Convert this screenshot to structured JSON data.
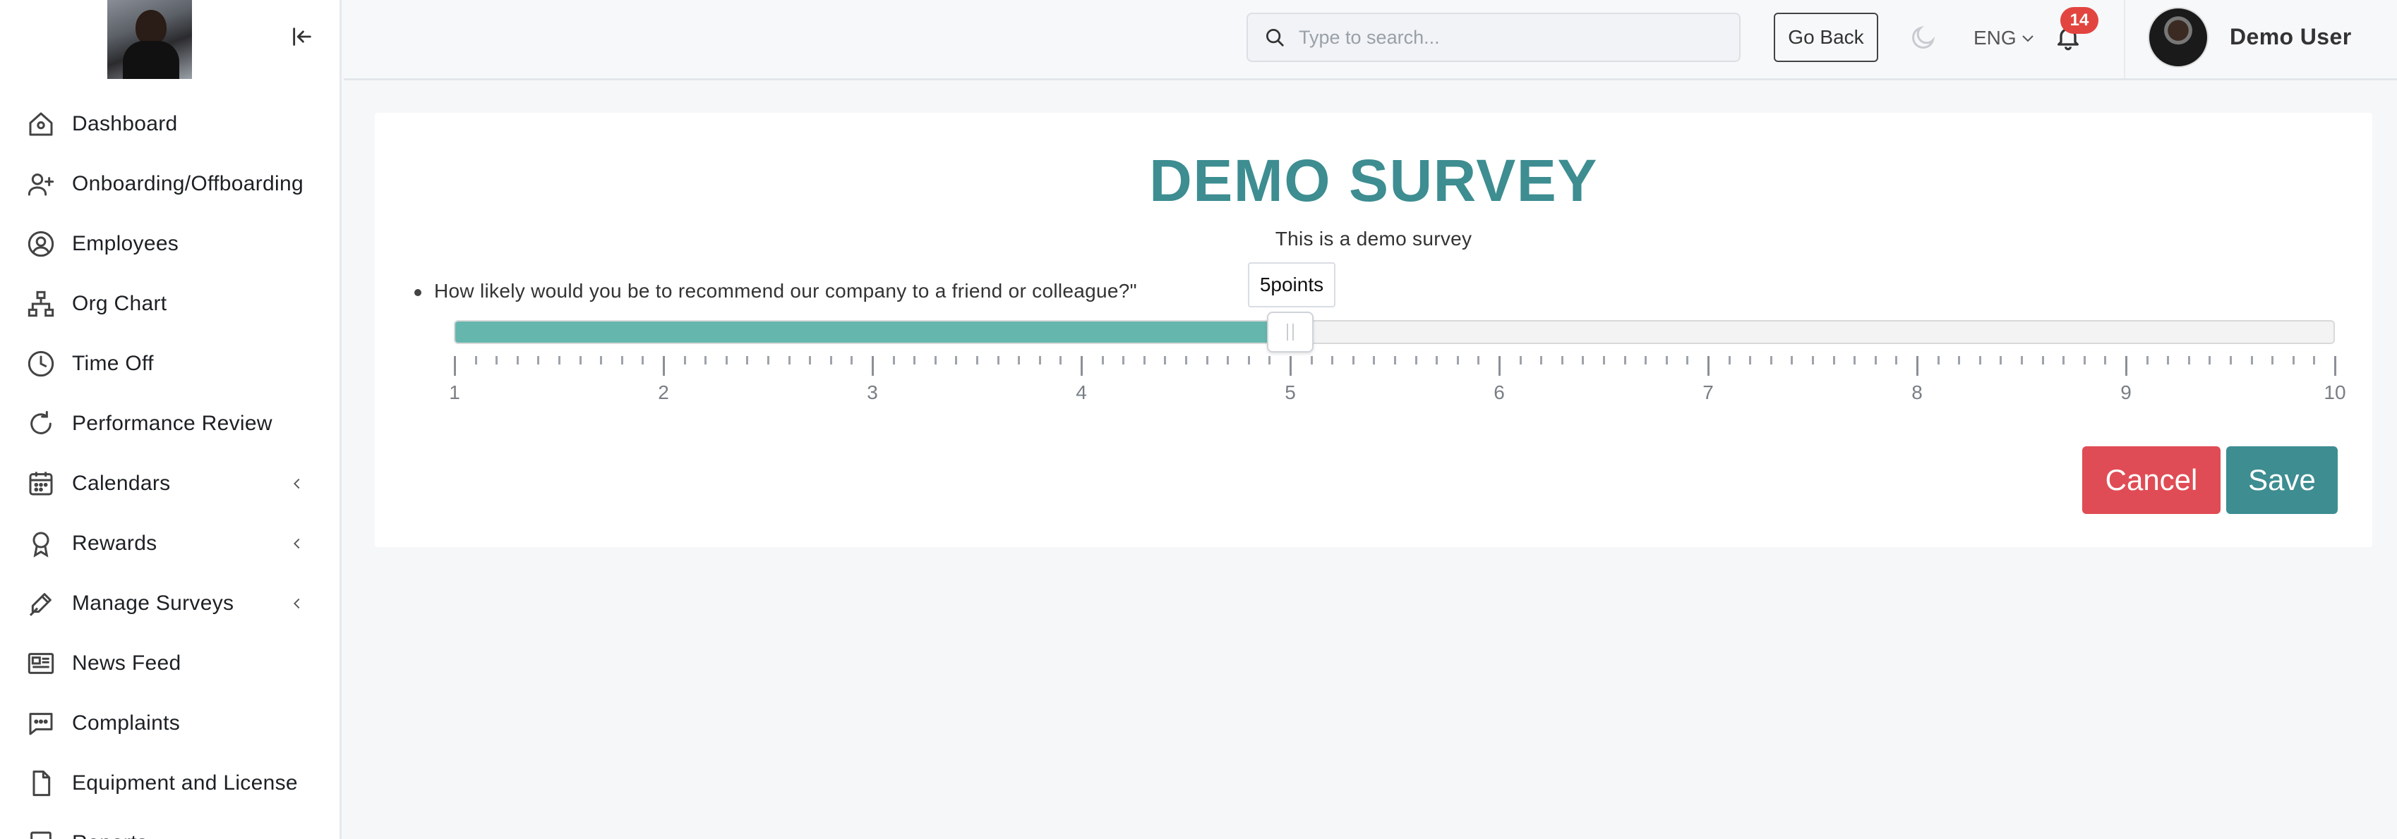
{
  "sidebar": {
    "items": [
      {
        "label": "Dashboard",
        "icon": "home-icon",
        "expandable": false
      },
      {
        "label": "Onboarding/Offboarding",
        "icon": "user-plus-icon",
        "expandable": false
      },
      {
        "label": "Employees",
        "icon": "user-circle-icon",
        "expandable": false
      },
      {
        "label": "Org Chart",
        "icon": "org-chart-icon",
        "expandable": false
      },
      {
        "label": "Time Off",
        "icon": "clock-icon",
        "expandable": false
      },
      {
        "label": "Performance Review",
        "icon": "refresh-icon",
        "expandable": false
      },
      {
        "label": "Calendars",
        "icon": "calendar-icon",
        "expandable": true
      },
      {
        "label": "Rewards",
        "icon": "award-icon",
        "expandable": true
      },
      {
        "label": "Manage Surveys",
        "icon": "pen-icon",
        "expandable": true
      },
      {
        "label": "News Feed",
        "icon": "newspaper-icon",
        "expandable": false
      },
      {
        "label": "Complaints",
        "icon": "message-icon",
        "expandable": false
      },
      {
        "label": "Equipment and License",
        "icon": "file-icon",
        "expandable": false
      },
      {
        "label": "Reports",
        "icon": "report-icon",
        "expandable": false
      }
    ]
  },
  "header": {
    "search_placeholder": "Type to search...",
    "go_back_label": "Go Back",
    "language": "ENG",
    "notification_count": "14",
    "user_name": "Demo User"
  },
  "survey": {
    "title": "DEMO SURVEY",
    "description": "This is a demo survey",
    "question": "How likely would you be to recommend our company to a friend or colleague?\"",
    "tooltip": "5points",
    "scale_min": 1,
    "scale_max": 10,
    "value": 5,
    "scale_labels": [
      "1",
      "2",
      "3",
      "4",
      "5",
      "6",
      "7",
      "8",
      "9",
      "10"
    ],
    "minor_ticks_per_step": 10,
    "cancel_label": "Cancel",
    "save_label": "Save"
  },
  "colors": {
    "accent": "#3d8d91",
    "slider_fill": "#65b7ae",
    "cancel": "#e04c55",
    "badge": "#e2453f"
  }
}
